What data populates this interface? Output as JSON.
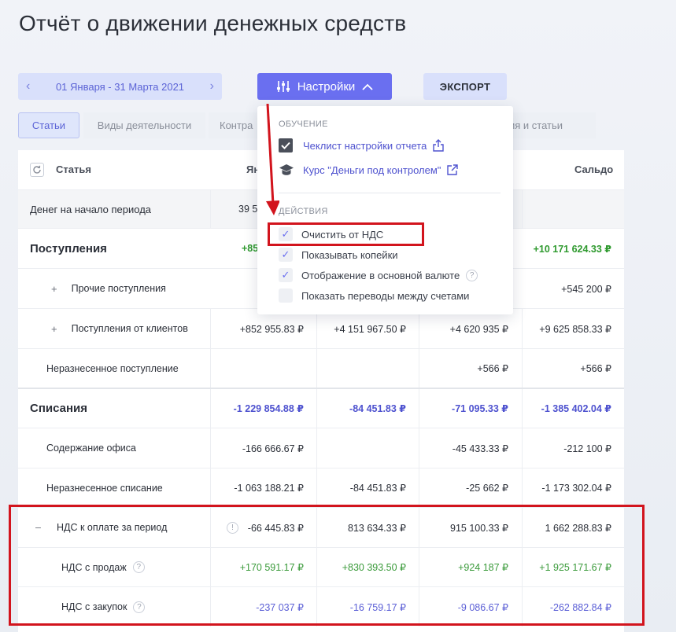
{
  "page": {
    "title": "Отчёт о движении денежных средств"
  },
  "toolbar": {
    "date_range": "01 Января - 31 Марта 2021",
    "prev_icon": "‹",
    "next_icon": "›",
    "settings_label": "Настройки",
    "export_label": "ЭКСПОРТ"
  },
  "tabs": [
    {
      "label": "Статьи"
    },
    {
      "label": "Виды деятельности"
    },
    {
      "label": "Контра"
    },
    {
      "label": "ления и статьи"
    }
  ],
  "table": {
    "headers": {
      "article": "Статья",
      "col1": "Ян",
      "balance": "Сальдо"
    },
    "rows": [
      {
        "name": "Денег на начало периода",
        "c1": "39 5",
        "c2": "",
        "c3": "",
        "c4": ""
      },
      {
        "name": "Поступления",
        "c1": "+85",
        "c2": "",
        "c3": "",
        "c4": "+10 171 624.33 ₽"
      },
      {
        "name": "Прочие поступления",
        "c1": "",
        "c2": "",
        "c3": "",
        "c4": "+545 200 ₽"
      },
      {
        "name": "Поступления от клиентов",
        "c1": "+852 955.83 ₽",
        "c2": "+4 151 967.50 ₽",
        "c3": "+4 620 935 ₽",
        "c4": "+9 625 858.33 ₽"
      },
      {
        "name": "Неразнесенное поступление",
        "c1": "",
        "c2": "",
        "c3": "+566 ₽",
        "c4": "+566 ₽"
      },
      {
        "name": "Списания",
        "c1": "-1 229 854.88 ₽",
        "c2": "-84 451.83 ₽",
        "c3": "-71 095.33 ₽",
        "c4": "-1 385 402.04 ₽"
      },
      {
        "name": "Содержание офиса",
        "c1": "-166 666.67 ₽",
        "c2": "",
        "c3": "-45 433.33 ₽",
        "c4": "-212 100 ₽"
      },
      {
        "name": "Неразнесенное списание",
        "c1": "-1 063 188.21 ₽",
        "c2": "-84 451.83 ₽",
        "c3": "-25 662 ₽",
        "c4": "-1 173 302.04 ₽"
      },
      {
        "name": "НДС к оплате за период",
        "c1": "-66 445.83 ₽",
        "c2": "813 634.33 ₽",
        "c3": "915 100.33 ₽",
        "c4": "1 662 288.83 ₽"
      },
      {
        "name": "НДС с продаж",
        "c1": "+170 591.17 ₽",
        "c2": "+830 393.50 ₽",
        "c3": "+924 187 ₽",
        "c4": "+1 925 171.67 ₽"
      },
      {
        "name": "НДС с закупок",
        "c1": "-237 037 ₽",
        "c2": "-16 759.17 ₽",
        "c3": "-9 086.67 ₽",
        "c4": "-262 882.84 ₽"
      }
    ],
    "expand_plus": "+",
    "collapse_minus": "–",
    "question_mark": "?",
    "info_mark": "!"
  },
  "settings_menu": {
    "section_learning": "ОБУЧЕНИЕ",
    "checklist_link": "Чеклист настройки отчета",
    "course_link": "Курс \"Деньги под контролем\"",
    "section_actions": "ДЕЙСТВИЯ",
    "options": [
      {
        "label": "Очистить от НДС",
        "checked": true
      },
      {
        "label": "Показывать копейки",
        "checked": true
      },
      {
        "label": "Отображение в основной валюте",
        "checked": true
      },
      {
        "label": "Показать переводы между счетами",
        "checked": false
      }
    ],
    "check_glyph": "✓"
  },
  "colors": {
    "accent": "#6a6ff0",
    "accent_light": "#d9e0fb",
    "positive": "#3a9a3a",
    "negative": "#5b5fd6",
    "annotation": "#d2141d"
  }
}
